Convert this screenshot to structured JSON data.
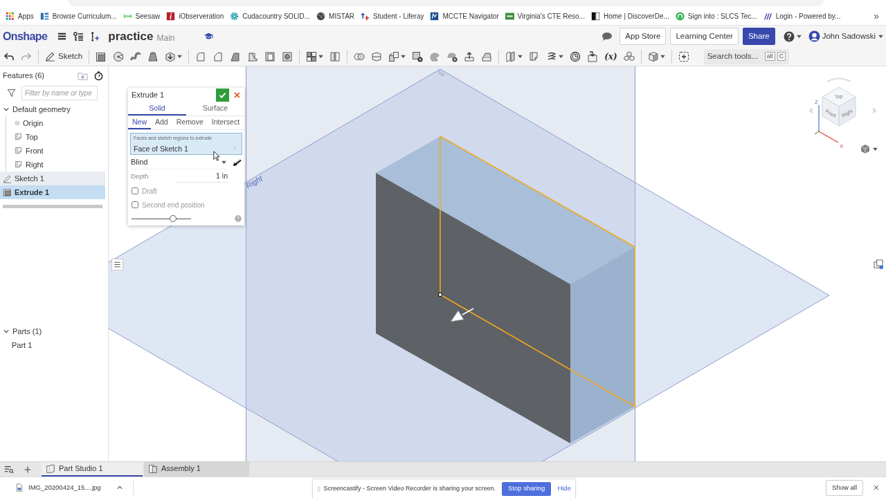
{
  "browser": {
    "bookmarks": [
      {
        "label": "Apps"
      },
      {
        "label": "Browse Curriculum..."
      },
      {
        "label": "Seesaw"
      },
      {
        "label": "iObserveration"
      },
      {
        "label": "Cudacountry SOLID..."
      },
      {
        "label": "MISTAR"
      },
      {
        "label": "Student - Liferay"
      },
      {
        "label": "MCCTE Navigator"
      },
      {
        "label": "Virginia's CTE Reso..."
      },
      {
        "label": "Home | DiscoverDe..."
      },
      {
        "label": "Sign into : SLCS Tec..."
      },
      {
        "label": "Login - Powered by..."
      }
    ],
    "more": "»"
  },
  "header": {
    "logo": "Onshape",
    "document": "practice",
    "workspace": "Main",
    "buttons": [
      {
        "label": "App Store",
        "kind": "outline"
      },
      {
        "label": "Learning Center",
        "kind": "outline"
      },
      {
        "label": "Share",
        "kind": "primary"
      }
    ],
    "user": "John Sadowski"
  },
  "toolbar": {
    "sketch": "Sketch",
    "variables": "(x)",
    "search": {
      "placeholder": "Search tools...",
      "keys": [
        "alt",
        "C"
      ]
    }
  },
  "features": {
    "title": "Features (6)",
    "filter": {
      "placeholder": "Filter by name or type"
    },
    "tree": [
      {
        "label": "Default geometry",
        "kind": "group",
        "expanded": true,
        "selected": false,
        "hovered": false,
        "children": [
          {
            "label": "Origin",
            "kind": "point",
            "selected": false,
            "hovered": false
          },
          {
            "label": "Top",
            "kind": "plane",
            "selected": false,
            "hovered": false
          },
          {
            "label": "Front",
            "kind": "plane",
            "selected": false,
            "hovered": false
          },
          {
            "label": "Right",
            "kind": "plane",
            "selected": false,
            "hovered": false
          }
        ]
      },
      {
        "label": "Sketch 1",
        "kind": "sketch",
        "selected": false,
        "hovered": true
      },
      {
        "label": "Extrude 1",
        "kind": "extrude",
        "selected": true,
        "hovered": false
      }
    ]
  },
  "parts": {
    "title": "Parts (1)",
    "expanded": true,
    "items": [
      {
        "label": "Part 1",
        "selected": false
      }
    ]
  },
  "dialog": {
    "title": "Extrude 1",
    "body_types": [
      {
        "label": "Solid",
        "selected": true
      },
      {
        "label": "Surface",
        "selected": false
      }
    ],
    "operations": [
      {
        "label": "New",
        "selected": true
      },
      {
        "label": "Add",
        "selected": false
      },
      {
        "label": "Remove",
        "selected": false
      },
      {
        "label": "Intersect",
        "selected": false
      }
    ],
    "selection": {
      "label": "Faces and sketch regions to extrude",
      "value": "Face of Sketch 1"
    },
    "end_type": "Blind",
    "depth": {
      "label": "Depth",
      "value": "1 in"
    },
    "options": [
      {
        "label": "Draft",
        "checked": false
      },
      {
        "label": "Second end position",
        "checked": false
      }
    ],
    "slider": {
      "level": 0.7
    }
  },
  "viewport": {
    "plane_labels": [
      "Right",
      "Top"
    ],
    "view_cube": {
      "faces": [
        "Top",
        "Front",
        "Right"
      ],
      "axes": [
        "Z",
        "X"
      ]
    }
  },
  "tabs": [
    {
      "label": "Part Studio 1",
      "kind": "part_studio",
      "selected": true
    },
    {
      "label": "Assembly 1",
      "kind": "assembly",
      "selected": false
    }
  ],
  "downloads": {
    "items": [
      {
        "label": "IMG_20200424_15....jpg"
      }
    ],
    "show_all": "Show all"
  },
  "notification": {
    "text": "Screencastify - Screen Video Recorder is sharing your screen.",
    "action": "Stop sharing",
    "dismiss": "Hide"
  }
}
